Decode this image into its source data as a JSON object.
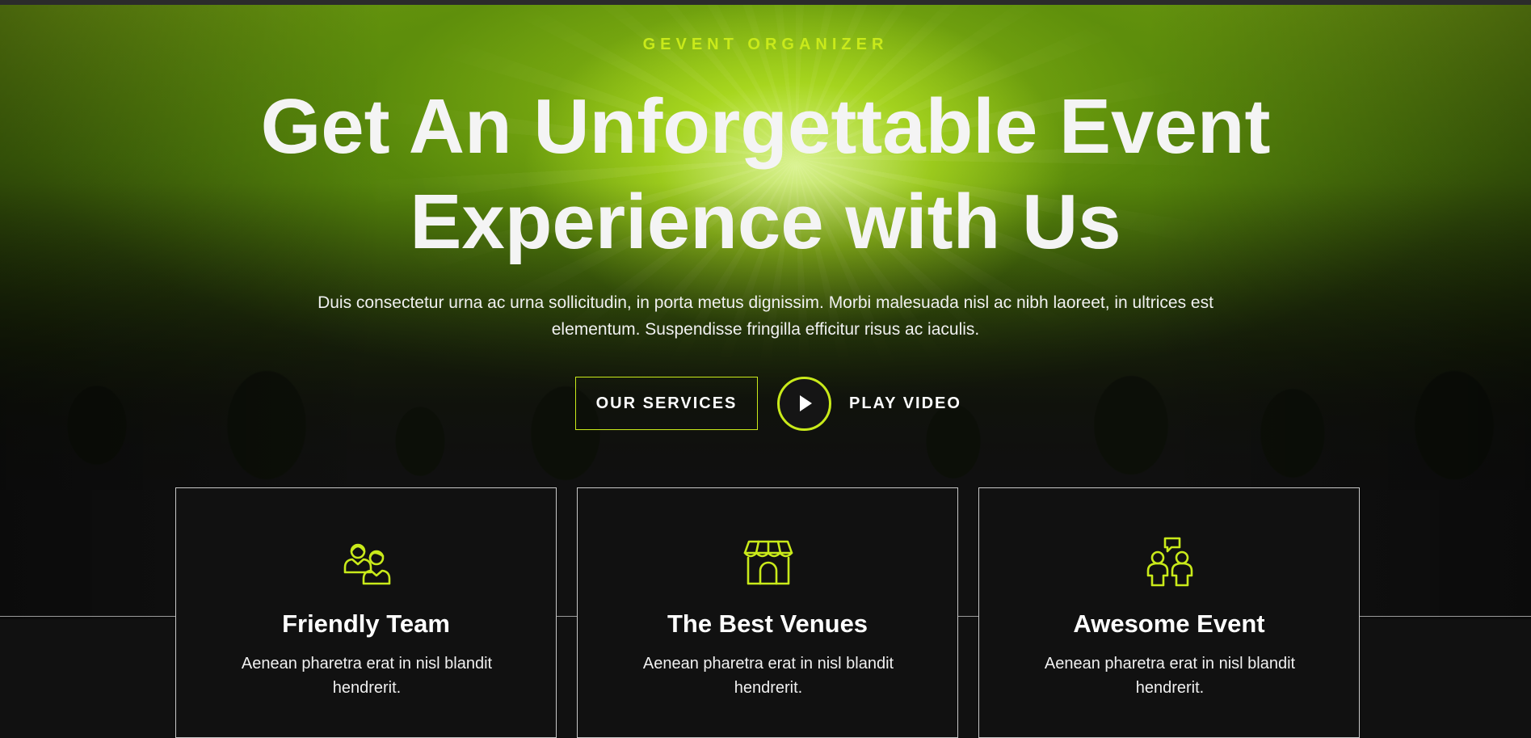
{
  "hero": {
    "eyebrow": "GEVENT ORGANIZER",
    "headline_line1": "Get An Unforgettable Event",
    "headline_line2": "Experience with Us",
    "subtext": "Duis consectetur urna ac urna sollicitudin, in porta metus dignissim. Morbi malesuada nisl ac nibh laoreet, in ultrices est elementum. Suspendisse fringilla efficitur risus ac iaculis.",
    "services_button": "OUR SERVICES",
    "play_label": "PLAY VIDEO",
    "play_icon": "play-icon"
  },
  "features": [
    {
      "icon": "team-icon",
      "title": "Friendly Team",
      "description": "Aenean pharetra erat in nisl blandit hendrerit."
    },
    {
      "icon": "venue-icon",
      "title": "The Best Venues",
      "description": "Aenean pharetra erat in nisl blandit hendrerit."
    },
    {
      "icon": "event-icon",
      "title": "Awesome Event",
      "description": "Aenean pharetra erat in nisl blandit hendrerit."
    }
  ],
  "colors": {
    "accent": "#c9ea1a",
    "background": "#111111",
    "text": "#ffffff"
  }
}
